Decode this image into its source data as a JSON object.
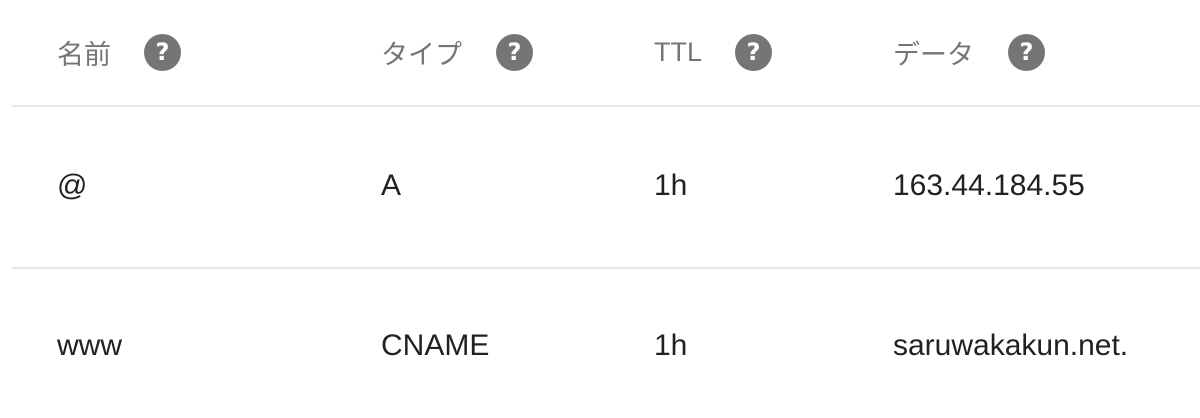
{
  "table": {
    "headers": [
      {
        "label": "名前",
        "help_icon": "help-icon"
      },
      {
        "label": "タイプ",
        "help_icon": "help-icon"
      },
      {
        "label": "TTL",
        "help_icon": "help-icon"
      },
      {
        "label": "データ",
        "help_icon": "help-icon"
      }
    ],
    "help_glyph": "?",
    "rows": [
      {
        "name": "@",
        "type": "A",
        "ttl": "1h",
        "data": "163.44.184.55"
      },
      {
        "name": "www",
        "type": "CNAME",
        "ttl": "1h",
        "data": "saruwakakun.net."
      }
    ]
  },
  "colors": {
    "header_text": "#757575",
    "icon_background": "#757575",
    "cell_text": "#212121",
    "divider": "#e6e6e6"
  }
}
